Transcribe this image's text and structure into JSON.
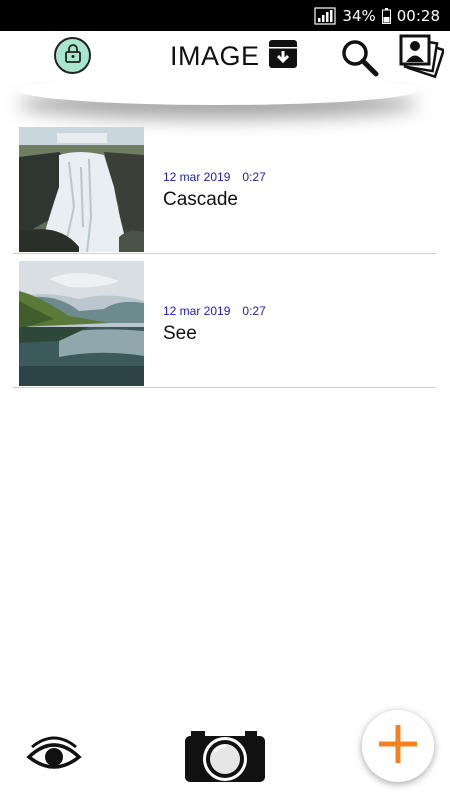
{
  "status_bar": {
    "battery": "34%",
    "time": "00:28",
    "icons": [
      "signal-icon",
      "battery-icon"
    ]
  },
  "app_bar": {
    "title": "IMAGE",
    "icons": [
      "lock-icon",
      "archive-download-icon",
      "search-icon",
      "gallery-icon"
    ],
    "lock_bg_color": "#a8e6cf"
  },
  "items": [
    {
      "date": "12 mar 2019",
      "time": "0:27",
      "title": "Cascade",
      "thumbnail": "waterfall-photo"
    },
    {
      "date": "12 mar 2019",
      "time": "0:27",
      "title": "See",
      "thumbnail": "lake-photo"
    }
  ],
  "bottom_bar": {
    "icons": [
      "eye-icon",
      "camera-icon",
      "add-icon"
    ],
    "fab_color": "#f5821f"
  },
  "colors": {
    "date_text": "#1a1ad0",
    "divider": "#cfcfcf"
  }
}
